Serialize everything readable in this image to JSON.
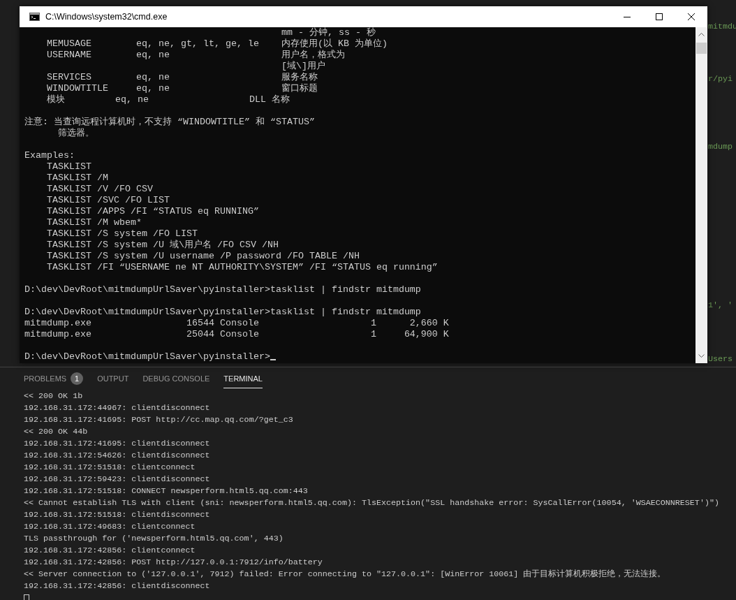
{
  "editor": {
    "fragments": [
      "mitmdu",
      "r/pyi",
      "mdump",
      "1', '",
      "Users"
    ]
  },
  "cmd_window": {
    "title": "C:\\Windows\\system32\\cmd.exe",
    "blocks": [
      [
        "                                              mm - 分钟, ss - 秒",
        "    MEMUSAGE        eq, ne, gt, lt, ge, le    内存使用(以 KB 为单位)",
        "    USERNAME        eq, ne                    用户名，格式为",
        "                                              [域\\]用户",
        "    SERVICES        eq, ne                    服务名称",
        "    WINDOWTITLE     eq, ne                    窗口标题",
        "    模块         eq, ne                  DLL 名称"
      ],
      [
        "注意: 当查询远程计算机时，不支持 “WINDOWTITLE” 和 “STATUS”",
        "      筛选器。"
      ],
      [
        "Examples:",
        "    TASKLIST",
        "    TASKLIST /M",
        "    TASKLIST /V /FO CSV",
        "    TASKLIST /SVC /FO LIST",
        "    TASKLIST /APPS /FI “STATUS eq RUNNING”",
        "    TASKLIST /M wbem*",
        "    TASKLIST /S system /FO LIST",
        "    TASKLIST /S system /U 域\\用户名 /FO CSV /NH",
        "    TASKLIST /S system /U username /P password /FO TABLE /NH",
        "    TASKLIST /FI “USERNAME ne NT AUTHORITY\\SYSTEM” /FI “STATUS eq running”"
      ],
      [
        "D:\\dev\\DevRoot\\mitmdumpUrlSaver\\pyinstaller>tasklist | findstr mitmdump"
      ],
      [
        "D:\\dev\\DevRoot\\mitmdumpUrlSaver\\pyinstaller>tasklist | findstr mitmdump",
        "mitmdump.exe                 16544 Console                    1      2,660 K",
        "mitmdump.exe                 25044 Console                    1     64,900 K"
      ],
      [
        "D:\\dev\\DevRoot\\mitmdumpUrlSaver\\pyinstaller>"
      ]
    ]
  },
  "panel": {
    "tabs": [
      {
        "label": "PROBLEMS",
        "badge": "1",
        "selected": false
      },
      {
        "label": "OUTPUT",
        "selected": false
      },
      {
        "label": "DEBUG CONSOLE",
        "selected": false
      },
      {
        "label": "TERMINAL",
        "selected": true
      }
    ],
    "terminal_lines": [
      "<< 200 OK 1b",
      "192.168.31.172:44967: clientdisconnect",
      "192.168.31.172:41695: POST http://cc.map.qq.com/?get_c3",
      "<< 200 OK 44b",
      "192.168.31.172:41695: clientdisconnect",
      "192.168.31.172:54626: clientdisconnect",
      "192.168.31.172:51518: clientconnect",
      "192.168.31.172:59423: clientdisconnect",
      "192.168.31.172:51518: CONNECT newsperform.html5.qq.com:443",
      "<< Cannot establish TLS with client (sni: newsperform.html5.qq.com): TlsException(\"SSL handshake error: SysCallError(10054, 'WSAECONNRESET')\")",
      "192.168.31.172:51518: clientdisconnect",
      "192.168.31.172:49683: clientconnect",
      "TLS passthrough for ('newsperform.html5.qq.com', 443)",
      "192.168.31.172:42856: clientconnect",
      "192.168.31.172:42856: POST http://127.0.0.1:7912/info/battery",
      "<< Server connection to ('127.0.0.1', 7912) failed: Error connecting to \"127.0.0.1\": [WinError 10061] 由于目标计算机积极拒绝，无法连接。",
      "192.168.31.172:42856: clientdisconnect"
    ]
  }
}
